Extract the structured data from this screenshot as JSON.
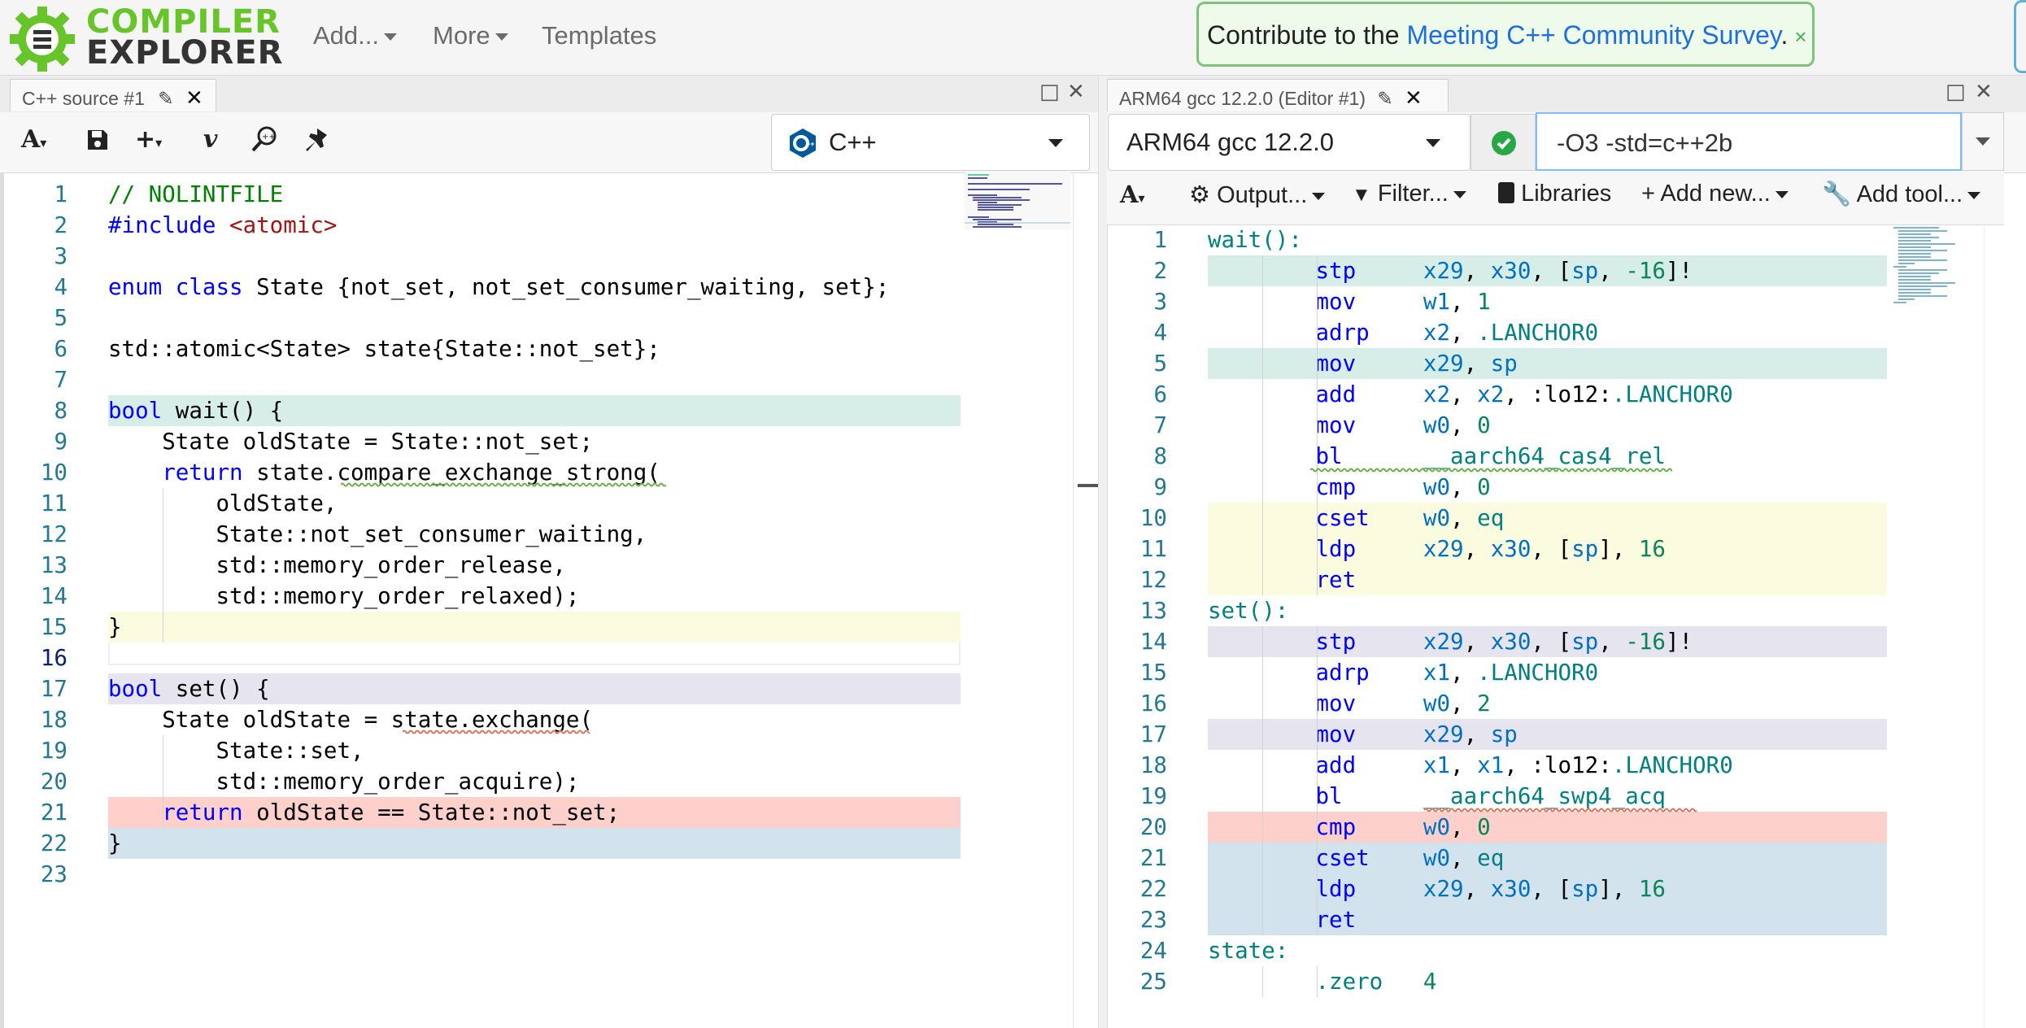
{
  "brand": {
    "line1": "COMPILER",
    "line2": "EXPLORER"
  },
  "nav": {
    "add": "Add...",
    "more": "More",
    "templates": "Templates"
  },
  "notice": {
    "prefix": "Contribute to the ",
    "link": "Meeting C++ Community Survey",
    "suffix": ".",
    "close": "×"
  },
  "left_pane": {
    "tab_title": "C++ source #1",
    "language": "C++",
    "lines": [
      "// NOLINTFILE",
      "#include <atomic>",
      "",
      "enum class State {not_set, not_set_consumer_waiting, set};",
      "",
      "std::atomic<State> state{State::not_set};",
      "",
      "bool wait() {",
      "    State oldState = State::not_set;",
      "    return state.compare_exchange_strong(",
      "        oldState,",
      "        State::not_set_consumer_waiting,",
      "        std::memory_order_release,",
      "        std::memory_order_relaxed);",
      "}",
      "",
      "bool set() {",
      "    State oldState = state.exchange(",
      "        State::set,",
      "        std::memory_order_acquire);",
      "    return oldState == State::not_set;",
      "}",
      ""
    ]
  },
  "right_pane": {
    "tab_title": "ARM64 gcc 12.2.0 (Editor #1)",
    "compiler": "ARM64 gcc 12.2.0",
    "options": "-O3 -std=c++2b",
    "toolbar": {
      "output": "Output...",
      "filter": "Filter...",
      "libraries": "Libraries",
      "add_new": "Add new...",
      "add_tool": "Add tool..."
    },
    "lines": [
      "wait():",
      "        stp     x29, x30, [sp, -16]!",
      "        mov     w1, 1",
      "        adrp    x2, .LANCHOR0",
      "        mov     x29, sp",
      "        add     x2, x2, :lo12:.LANCHOR0",
      "        mov     w0, 0",
      "        bl      __aarch64_cas4_rel",
      "        cmp     w0, 0",
      "        cset    w0, eq",
      "        ldp     x29, x30, [sp], 16",
      "        ret",
      "set():",
      "        stp     x29, x30, [sp, -16]!",
      "        adrp    x1, .LANCHOR0",
      "        mov     w0, 2",
      "        mov     x29, sp",
      "        add     x1, x1, :lo12:.LANCHOR0",
      "        bl      __aarch64_swp4_acq",
      "        cmp     w0, 0",
      "        cset    w0, eq",
      "        ldp     x29, x30, [sp], 16",
      "        ret",
      "state:",
      "        .zero   4"
    ]
  },
  "colors": {
    "teal": "#d6ede8",
    "yellow": "#fbfbe0",
    "purple": "#e6e4ef",
    "red": "#fdd0cc",
    "blue": "#d3e3ee"
  }
}
